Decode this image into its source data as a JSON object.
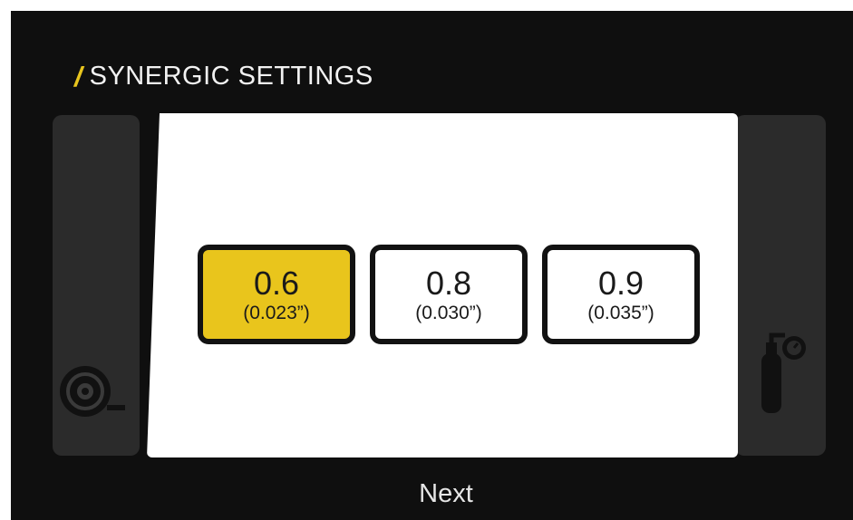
{
  "header": {
    "slash": "/",
    "title": "SYNERGIC SETTINGS"
  },
  "options": [
    {
      "mm": "0.6",
      "inch": "(0.023”)",
      "selected": true
    },
    {
      "mm": "0.8",
      "inch": "(0.030”)",
      "selected": false
    },
    {
      "mm": "0.9",
      "inch": "(0.035”)",
      "selected": false
    }
  ],
  "footer": {
    "next_label": "Next"
  },
  "colors": {
    "accent": "#e9c51c",
    "background": "#0f0f0f",
    "side_panel": "#2b2b2b"
  },
  "icons": {
    "left": "wire-spool-icon",
    "right": "gas-cylinder-icon"
  }
}
